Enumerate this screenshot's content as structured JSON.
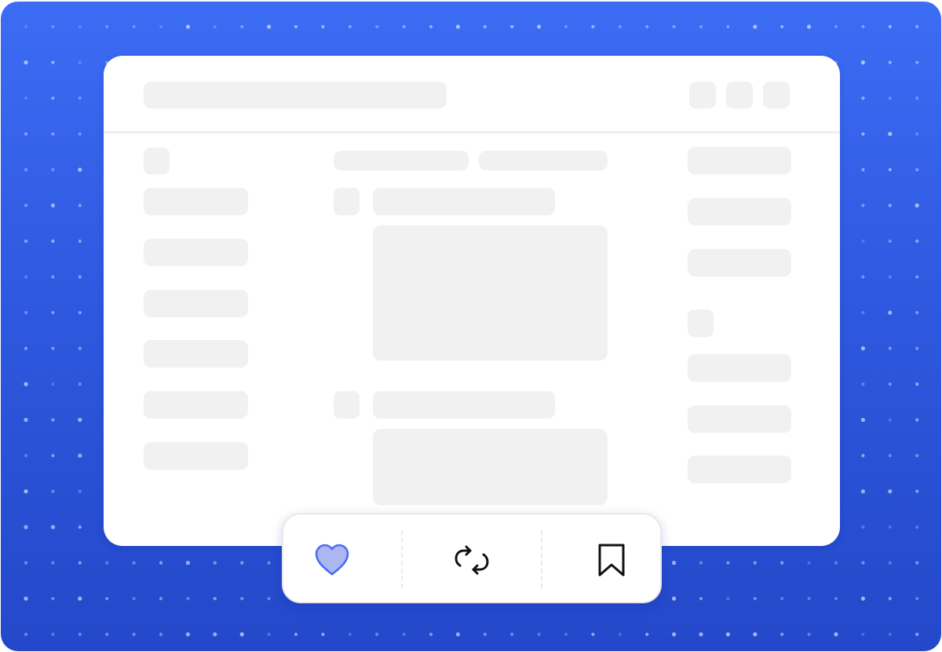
{
  "colors": {
    "background_top": "#3d6cf4",
    "background_bottom": "#2448c9",
    "window": "#ffffff",
    "skeleton": "#f1f1f1",
    "heart_fill": "#aab7f0",
    "heart_stroke": "#4d6cf2",
    "icon_stroke": "#111111"
  },
  "actions": {
    "like": {
      "icon": "heart-icon",
      "state": "active"
    },
    "repost": {
      "icon": "repost-icon"
    },
    "bookmark": {
      "icon": "bookmark-icon"
    }
  }
}
